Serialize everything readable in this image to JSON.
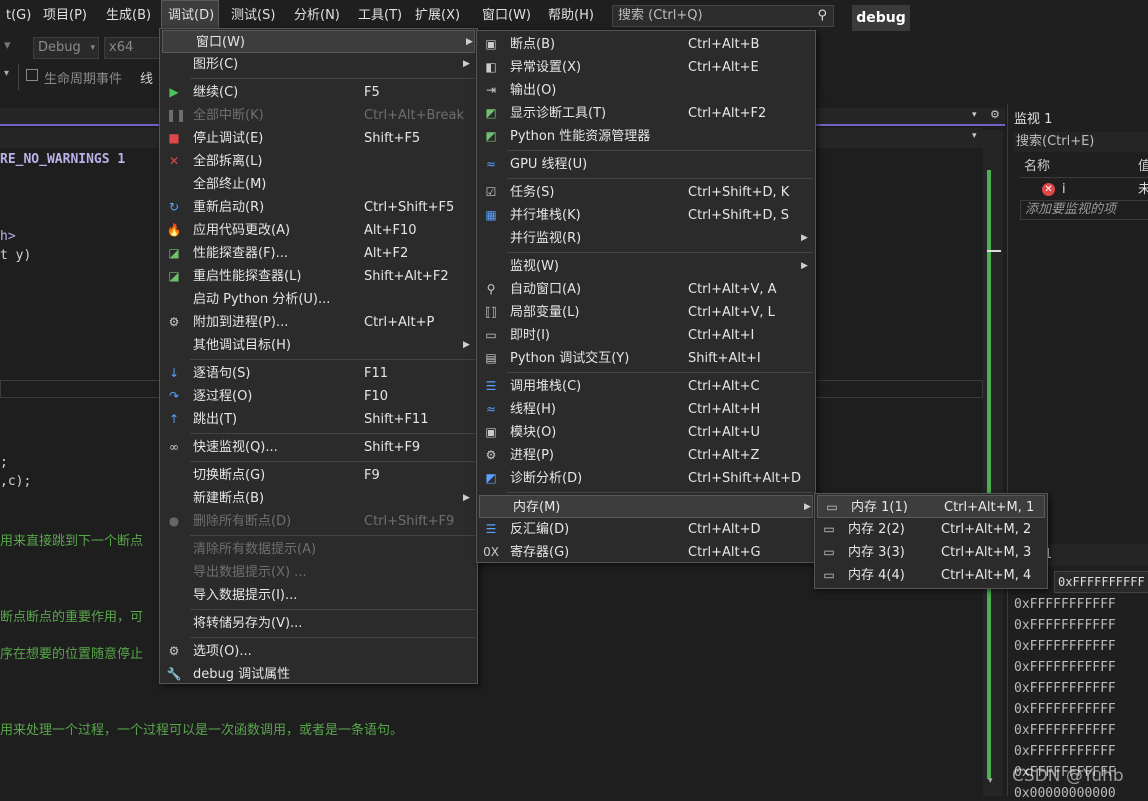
{
  "menubar": {
    "items": [
      "t(G)",
      "项目(P)",
      "生成(B)",
      "调试(D)",
      "测试(S)",
      "分析(N)",
      "工具(T)",
      "扩展(X)",
      "窗口(W)",
      "帮助(H)"
    ],
    "search_placeholder": "搜索 (Ctrl+Q)",
    "config_badge": "debug"
  },
  "toolbar": {
    "configuration": "Debug",
    "platform": "x64",
    "lifecycle": "生命周期事件",
    "thread_partial": "线"
  },
  "editor": {
    "lines": [
      {
        "text": "RE_NO_WARNINGS 1",
        "kind": "macro"
      },
      {
        "text": "h>",
        "kind": "include"
      },
      {
        "text": "t y)",
        "kind": "code"
      },
      {
        "text": ";",
        "kind": "code"
      },
      {
        "text": ",c);",
        "kind": "code"
      },
      {
        "text": "用来直接跳到下一个断点",
        "kind": "comment"
      },
      {
        "text": "断点断点的重要作用，可",
        "kind": "comment"
      },
      {
        "text": "序在想要的位置随意停止",
        "kind": "comment"
      },
      {
        "text": "用来处理一个过程，一个过程可以是一次函数调用，或者是一条语句。",
        "kind": "comment"
      }
    ]
  },
  "watch": {
    "title": "监视 1",
    "search": "搜索(Ctrl+E)",
    "col_name": "名称",
    "col_value_partial": "值",
    "row_name": "i",
    "row_value_partial": "未",
    "add_hint": "添加要监视的项"
  },
  "memory": {
    "address_partial": "0xFFFFFFFFFF",
    "rows": [
      "0xFFFFFFFFFFF",
      "0xFFFFFFFFFFF",
      "0xFFFFFFFFFFF",
      "0xFFFFFFFFFFF",
      "0xFFFFFFFFFFF",
      "0xFFFFFFFFFFF",
      "0xFFFFFFFFFFF",
      "0xFFFFFFFFFFF",
      "0xFFFFFFFFFFF",
      "0x00000000000"
    ]
  },
  "watermark": "CSDN @Yuhb",
  "debug_menu": [
    {
      "label": "窗口(W)",
      "shortcut": "",
      "icon": "",
      "submenu": true,
      "state": "highlighted"
    },
    {
      "label": "图形(C)",
      "shortcut": "",
      "icon": "",
      "submenu": true
    },
    {
      "sep": true
    },
    {
      "label": "继续(C)",
      "shortcut": "F5",
      "icon": "play-icon"
    },
    {
      "label": "全部中断(K)",
      "shortcut": "Ctrl+Alt+Break",
      "icon": "pause-icon",
      "disabled": true
    },
    {
      "label": "停止调试(E)",
      "shortcut": "Shift+F5",
      "icon": "stop-icon"
    },
    {
      "label": "全部拆离(L)",
      "shortcut": "",
      "icon": "detach-icon"
    },
    {
      "label": "全部终止(M)",
      "shortcut": "",
      "icon": ""
    },
    {
      "label": "重新启动(R)",
      "shortcut": "Ctrl+Shift+F5",
      "icon": "restart-icon"
    },
    {
      "label": "应用代码更改(A)",
      "shortcut": "Alt+F10",
      "icon": "hot-reload-icon"
    },
    {
      "label": "性能探查器(F)...",
      "shortcut": "Alt+F2",
      "icon": "profiler-icon"
    },
    {
      "label": "重启性能探查器(L)",
      "shortcut": "Shift+Alt+F2",
      "icon": "profiler-restart-icon"
    },
    {
      "label": "启动 Python 分析(U)...",
      "shortcut": "",
      "icon": ""
    },
    {
      "label": "附加到进程(P)...",
      "shortcut": "Ctrl+Alt+P",
      "icon": "attach-icon"
    },
    {
      "label": "其他调试目标(H)",
      "shortcut": "",
      "icon": "",
      "submenu": true
    },
    {
      "sep": true
    },
    {
      "label": "逐语句(S)",
      "shortcut": "F11",
      "icon": "step-into-icon"
    },
    {
      "label": "逐过程(O)",
      "shortcut": "F10",
      "icon": "step-over-icon"
    },
    {
      "label": "跳出(T)",
      "shortcut": "Shift+F11",
      "icon": "step-out-icon"
    },
    {
      "sep": true
    },
    {
      "label": "快速监视(Q)...",
      "shortcut": "Shift+F9",
      "icon": "glasses-icon"
    },
    {
      "sep": true
    },
    {
      "label": "切换断点(G)",
      "shortcut": "F9",
      "icon": ""
    },
    {
      "label": "新建断点(B)",
      "shortcut": "",
      "icon": "",
      "submenu": true
    },
    {
      "label": "删除所有断点(D)",
      "shortcut": "Ctrl+Shift+F9",
      "icon": "breakpoints-icon",
      "disabled": true
    },
    {
      "sep": true
    },
    {
      "label": "清除所有数据提示(A)",
      "shortcut": "",
      "icon": "",
      "disabled": true
    },
    {
      "label": "导出数据提示(X) ...",
      "shortcut": "",
      "icon": "",
      "disabled": true
    },
    {
      "label": "导入数据提示(I)...",
      "shortcut": "",
      "icon": ""
    },
    {
      "sep": true
    },
    {
      "label": "将转储另存为(V)...",
      "shortcut": "",
      "icon": ""
    },
    {
      "sep": true
    },
    {
      "label": "选项(O)...",
      "shortcut": "",
      "icon": "gear-icon"
    },
    {
      "label": "debug 调试属性",
      "shortcut": "",
      "icon": "wrench-icon"
    }
  ],
  "windows_menu": [
    {
      "label": "断点(B)",
      "shortcut": "Ctrl+Alt+B",
      "icon": "breakpoints-window-icon"
    },
    {
      "label": "异常设置(X)",
      "shortcut": "Ctrl+Alt+E",
      "icon": "exception-icon"
    },
    {
      "label": "输出(O)",
      "shortcut": "",
      "icon": "output-icon"
    },
    {
      "label": "显示诊断工具(T)",
      "shortcut": "Ctrl+Alt+F2",
      "icon": "diagnostics-icon"
    },
    {
      "label": "Python 性能资源管理器",
      "shortcut": "",
      "icon": "python-perf-icon"
    },
    {
      "sep": true
    },
    {
      "label": "GPU 线程(U)",
      "shortcut": "",
      "icon": "gpu-threads-icon"
    },
    {
      "sep": true
    },
    {
      "label": "任务(S)",
      "shortcut": "Ctrl+Shift+D, K",
      "icon": "tasks-icon"
    },
    {
      "label": "并行堆栈(K)",
      "shortcut": "Ctrl+Shift+D, S",
      "icon": "parallel-stacks-icon"
    },
    {
      "label": "并行监视(R)",
      "shortcut": "",
      "icon": "",
      "submenu": true
    },
    {
      "sep": true
    },
    {
      "label": "监视(W)",
      "shortcut": "",
      "icon": "",
      "submenu": true
    },
    {
      "label": "自动窗口(A)",
      "shortcut": "Ctrl+Alt+V, A",
      "icon": "autos-icon"
    },
    {
      "label": "局部变量(L)",
      "shortcut": "Ctrl+Alt+V, L",
      "icon": "locals-icon"
    },
    {
      "label": "即时(I)",
      "shortcut": "Ctrl+Alt+I",
      "icon": "immediate-icon"
    },
    {
      "label": "Python 调试交互(Y)",
      "shortcut": "Shift+Alt+I",
      "icon": "python-interactive-icon"
    },
    {
      "sep": true
    },
    {
      "label": "调用堆栈(C)",
      "shortcut": "Ctrl+Alt+C",
      "icon": "call-stack-icon"
    },
    {
      "label": "线程(H)",
      "shortcut": "Ctrl+Alt+H",
      "icon": "threads-icon"
    },
    {
      "label": "模块(O)",
      "shortcut": "Ctrl+Alt+U",
      "icon": "modules-icon"
    },
    {
      "label": "进程(P)",
      "shortcut": "Ctrl+Alt+Z",
      "icon": "processes-icon"
    },
    {
      "label": "诊断分析(D)",
      "shortcut": "Ctrl+Shift+Alt+D",
      "icon": "diagnostic-analysis-icon"
    },
    {
      "sep": true
    },
    {
      "label": "内存(M)",
      "shortcut": "",
      "icon": "",
      "submenu": true,
      "state": "highlighted"
    },
    {
      "label": "反汇编(D)",
      "shortcut": "Ctrl+Alt+D",
      "icon": "disassembly-icon"
    },
    {
      "label": "寄存器(G)",
      "shortcut": "Ctrl+Alt+G",
      "icon": "registers-icon"
    }
  ],
  "memory_menu": [
    {
      "label": "内存 1(1)",
      "shortcut": "Ctrl+Alt+M, 1",
      "icon": "memory-icon",
      "state": "highlighted"
    },
    {
      "label": "内存 2(2)",
      "shortcut": "Ctrl+Alt+M, 2",
      "icon": "memory-icon"
    },
    {
      "label": "内存 3(3)",
      "shortcut": "Ctrl+Alt+M, 3",
      "icon": "memory-icon"
    },
    {
      "label": "内存 4(4)",
      "shortcut": "Ctrl+Alt+M, 4",
      "icon": "memory-icon"
    }
  ],
  "colors": {
    "accent": "#6e64c8",
    "success_bar": "#4caf50",
    "comment": "#57a64a",
    "play": "#4cc35a",
    "stop": "#e04848"
  }
}
